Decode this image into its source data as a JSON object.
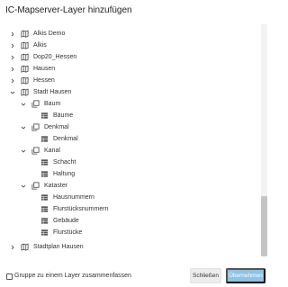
{
  "dialog": {
    "title": "IC-Mapserver-Layer hinzufügen"
  },
  "tree": {
    "items": [
      {
        "label": "Alkis Demo",
        "chevron": "right",
        "icon": "map-icon"
      },
      {
        "label": "Alkis",
        "chevron": "right",
        "icon": "map-icon"
      },
      {
        "label": "Dop20_Hessen",
        "chevron": "right",
        "icon": "map-icon"
      },
      {
        "label": "Hausen",
        "chevron": "right",
        "icon": "map-icon"
      },
      {
        "label": "Hessen",
        "chevron": "right",
        "icon": "map-icon"
      },
      {
        "label": "Stadt Hausen",
        "chevron": "down",
        "icon": "map-icon"
      },
      {
        "label": "Baum",
        "chevron": "down",
        "icon": "layer-group-icon"
      },
      {
        "label": "Bäume",
        "chevron": "",
        "icon": "layer-icon"
      },
      {
        "label": "Denkmal",
        "chevron": "down",
        "icon": "layer-group-icon"
      },
      {
        "label": "Denkmal",
        "chevron": "",
        "icon": "layer-icon"
      },
      {
        "label": "Kanal",
        "chevron": "down",
        "icon": "layer-group-icon"
      },
      {
        "label": "Schacht",
        "chevron": "",
        "icon": "layer-icon"
      },
      {
        "label": "Haltung",
        "chevron": "",
        "icon": "layer-icon"
      },
      {
        "label": "Kataster",
        "chevron": "down",
        "icon": "layer-group-icon"
      },
      {
        "label": "Hausnummern",
        "chevron": "",
        "icon": "layer-icon"
      },
      {
        "label": "Flurstücksnummern",
        "chevron": "",
        "icon": "layer-icon"
      },
      {
        "label": "Gebäude",
        "chevron": "",
        "icon": "layer-icon"
      },
      {
        "label": "Flurstücke",
        "chevron": "",
        "icon": "layer-icon"
      },
      {
        "label": "Stadtplan Hausen",
        "chevron": "right",
        "icon": "map-icon"
      }
    ]
  },
  "footer": {
    "merge_checkbox_label": "Gruppe zu einem Layer zusammenfassen",
    "merge_checked": false,
    "cancel_label": "Schließen",
    "apply_label": "Übernehmen"
  },
  "colors": {
    "apply_button": "#8fc3e3",
    "cancel_button": "#ededed",
    "scrollbar_thumb": "#c4c4c4",
    "text": "#333333"
  }
}
